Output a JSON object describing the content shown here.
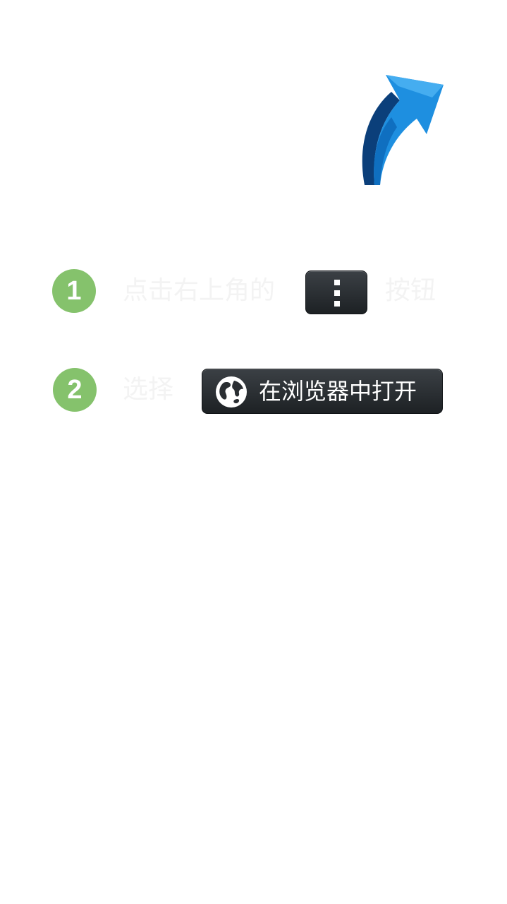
{
  "arrow": {
    "icon": "curved-arrow-up-right-icon",
    "colors": {
      "light": "#1e8fe0",
      "mid": "#0f6fc0",
      "dark": "#0b3f7a"
    }
  },
  "steps": [
    {
      "number": "1",
      "text_before": "点击右上角的",
      "button_icon": "vertical-dots-menu-icon",
      "text_after": "按钮"
    },
    {
      "number": "2",
      "text_before": "选择",
      "button_icon": "globe-icon",
      "button_label": "在浏览器中打开"
    }
  ],
  "colors": {
    "step_number_bg": "#85c26c",
    "button_bg": "#2a2e32",
    "instruction_text": "#f3f3f3"
  }
}
